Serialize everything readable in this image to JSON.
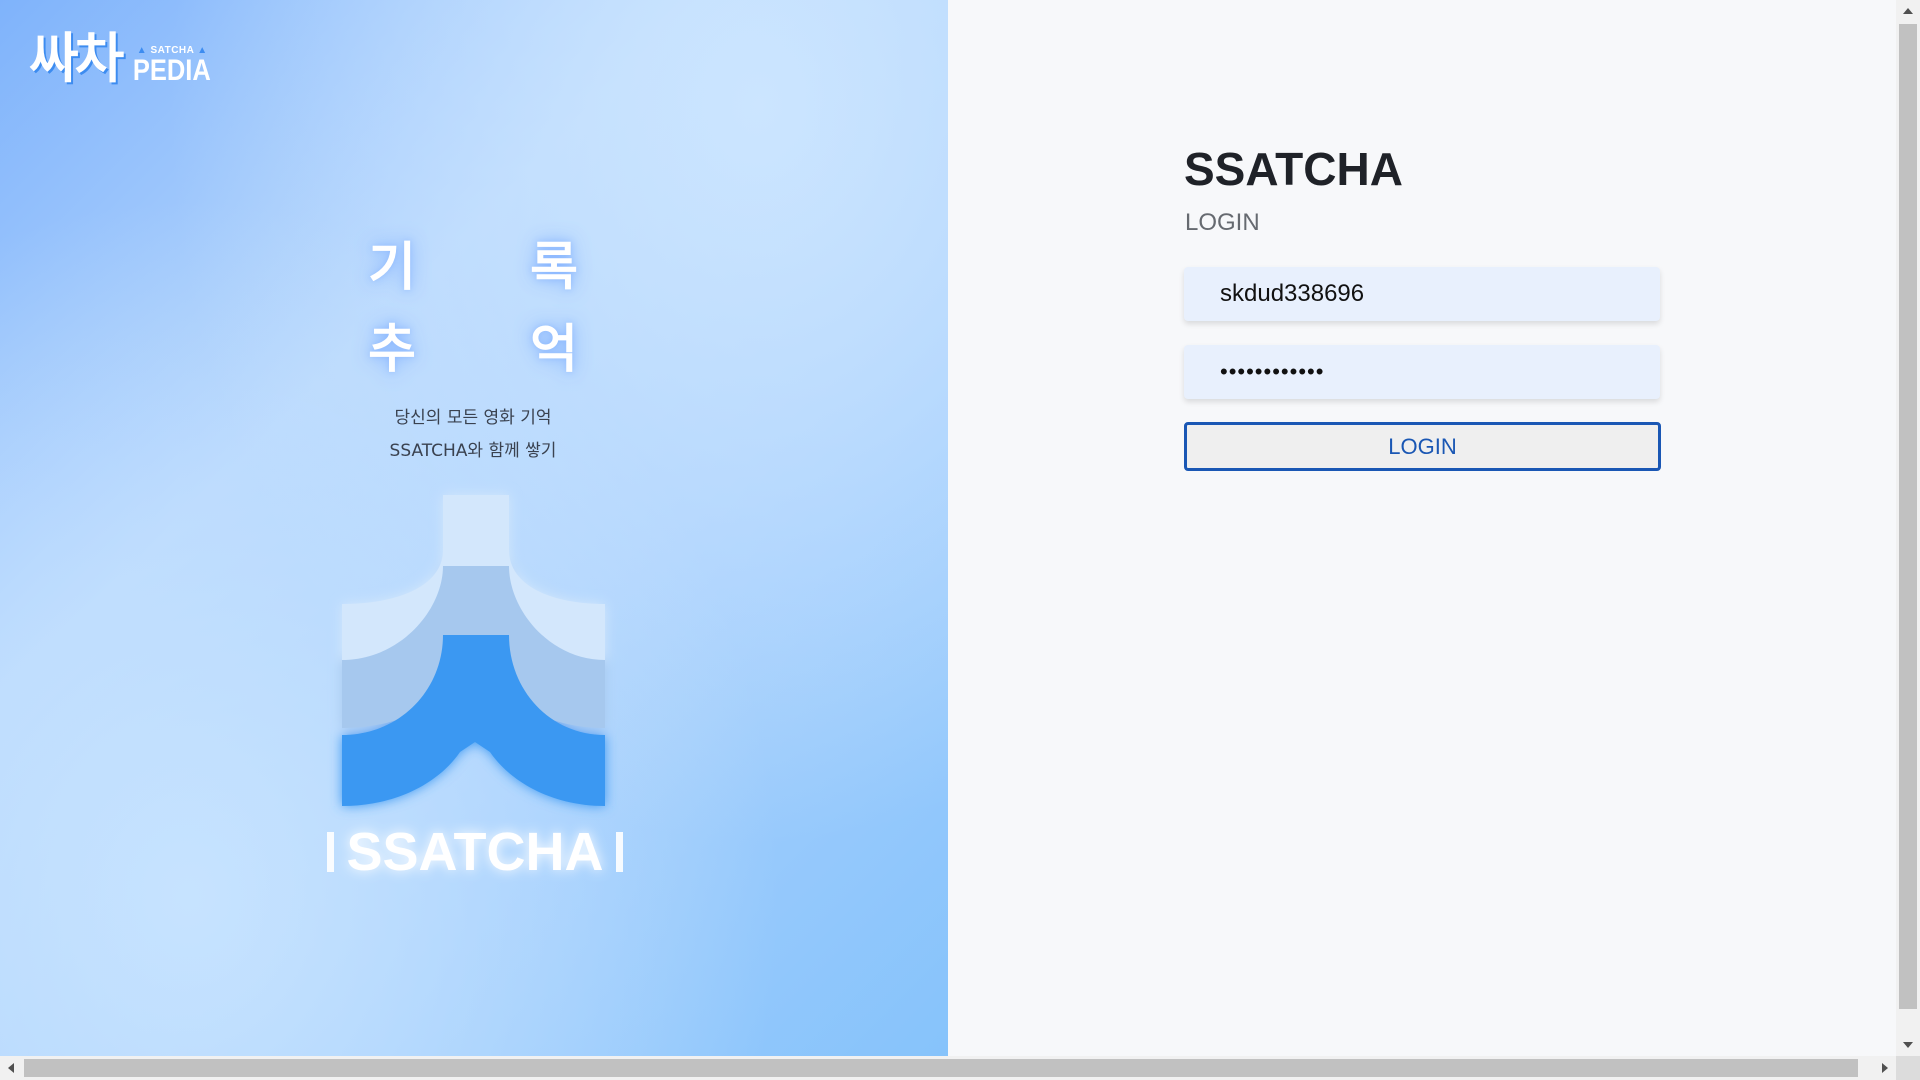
{
  "brand": {
    "logo_text": "싸차",
    "sub_text": "SATCHA",
    "pedia_text": "PEDIA"
  },
  "hero": {
    "glyphs": [
      "기",
      "록",
      "추",
      "억"
    ],
    "tagline_line1": "당신의 모든 영화 기억",
    "tagline_line2": "SSATCHA와 함께 쌓기",
    "emblem_text": "SSATCHA"
  },
  "login": {
    "title": "SSATCHA",
    "subtitle": "LOGIN",
    "username_value": "skdud338696",
    "password_value": "••••••••••••",
    "button_label": "LOGIN"
  },
  "colors": {
    "accent": "#1a57b4",
    "emblem_blue": "#3a98f2",
    "field_bg": "#e8f0fd"
  }
}
